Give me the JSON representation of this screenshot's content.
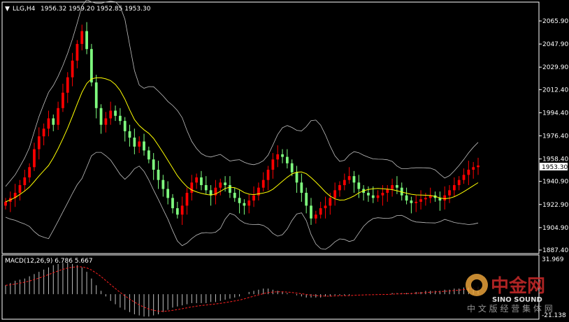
{
  "header": {
    "marker": "▼",
    "symbol": "LLG,H4",
    "ohlc": "1956.32 1959.20 1952.85 1953.30"
  },
  "price_axis": {
    "ticks": [
      "2065.90",
      "2047.90",
      "2029.90",
      "2012.40",
      "1994.40",
      "1976.40",
      "1958.40",
      "1940.90",
      "1922.90",
      "1904.90",
      "1887.40"
    ],
    "current_price": "1953.30"
  },
  "macd": {
    "label": "MACD(12,26,9) 6.786 5.667",
    "top_value": "31.969",
    "bottom_value": "-21.138"
  },
  "watermark": {
    "brand_cn": "中金网",
    "brand_en": "SINO SOUND",
    "tagline": "中 文 版 经 营 集 体 网"
  },
  "colors": {
    "background": "#000000",
    "bull": "#ff0000",
    "bear": "#7fff7f",
    "ma": "#ffff00",
    "bands": "#c0c0c0",
    "macd_signal": "#ff2020",
    "grid": "#ffffff"
  },
  "chart_data": {
    "type": "candlestick",
    "title": "LLG,H4",
    "y_range": [
      1887.4,
      2073.0
    ],
    "closes": [
      1925,
      1928,
      1932,
      1938,
      1944,
      1952,
      1966,
      1976,
      1982,
      1990,
      1985,
      1998,
      2010,
      2022,
      2035,
      2048,
      2058,
      2044,
      2018,
      1998,
      1985,
      1990,
      1996,
      1992,
      1988,
      1980,
      1975,
      1968,
      1972,
      1965,
      1958,
      1950,
      1942,
      1935,
      1928,
      1920,
      1915,
      1922,
      1932,
      1940,
      1944,
      1938,
      1934,
      1930,
      1936,
      1940,
      1938,
      1932,
      1928,
      1924,
      1922,
      1926,
      1930,
      1936,
      1942,
      1950,
      1958,
      1962,
      1960,
      1955,
      1948,
      1940,
      1932,
      1922,
      1912,
      1915,
      1920,
      1922,
      1928,
      1934,
      1938,
      1942,
      1945,
      1940,
      1935,
      1932,
      1930,
      1928,
      1930,
      1932,
      1935,
      1938,
      1936,
      1930,
      1926,
      1924,
      1925,
      1927,
      1928,
      1930,
      1928,
      1926,
      1930,
      1934,
      1938,
      1942,
      1946,
      1950,
      1952,
      1953.3
    ],
    "macd_values": [
      8,
      10,
      12,
      13,
      14,
      16,
      18,
      20,
      22,
      24,
      26,
      27,
      28,
      28,
      27,
      26,
      24,
      20,
      14,
      8,
      3,
      -2,
      -6,
      -9,
      -12,
      -14,
      -16,
      -18,
      -19,
      -20,
      -20,
      -19,
      -18,
      -16,
      -14,
      -12,
      -11,
      -10,
      -9,
      -8,
      -8,
      -8,
      -8,
      -7,
      -7,
      -6,
      -5,
      -4,
      -3,
      -2,
      0,
      2,
      3,
      4,
      5,
      5,
      4,
      3,
      2,
      1,
      0,
      -1,
      -2,
      -3,
      -3,
      -3,
      -3,
      -2,
      -2,
      -1,
      -1,
      -1,
      -1,
      0,
      0,
      0,
      0,
      0,
      0,
      0,
      0,
      1,
      1,
      1,
      1,
      1,
      2,
      2,
      3,
      3,
      3,
      3,
      4,
      4,
      5,
      5,
      6,
      6,
      6,
      6.786
    ],
    "macd_signal_value": 5.667,
    "macd_range": [
      -21.138,
      31.969
    ]
  }
}
